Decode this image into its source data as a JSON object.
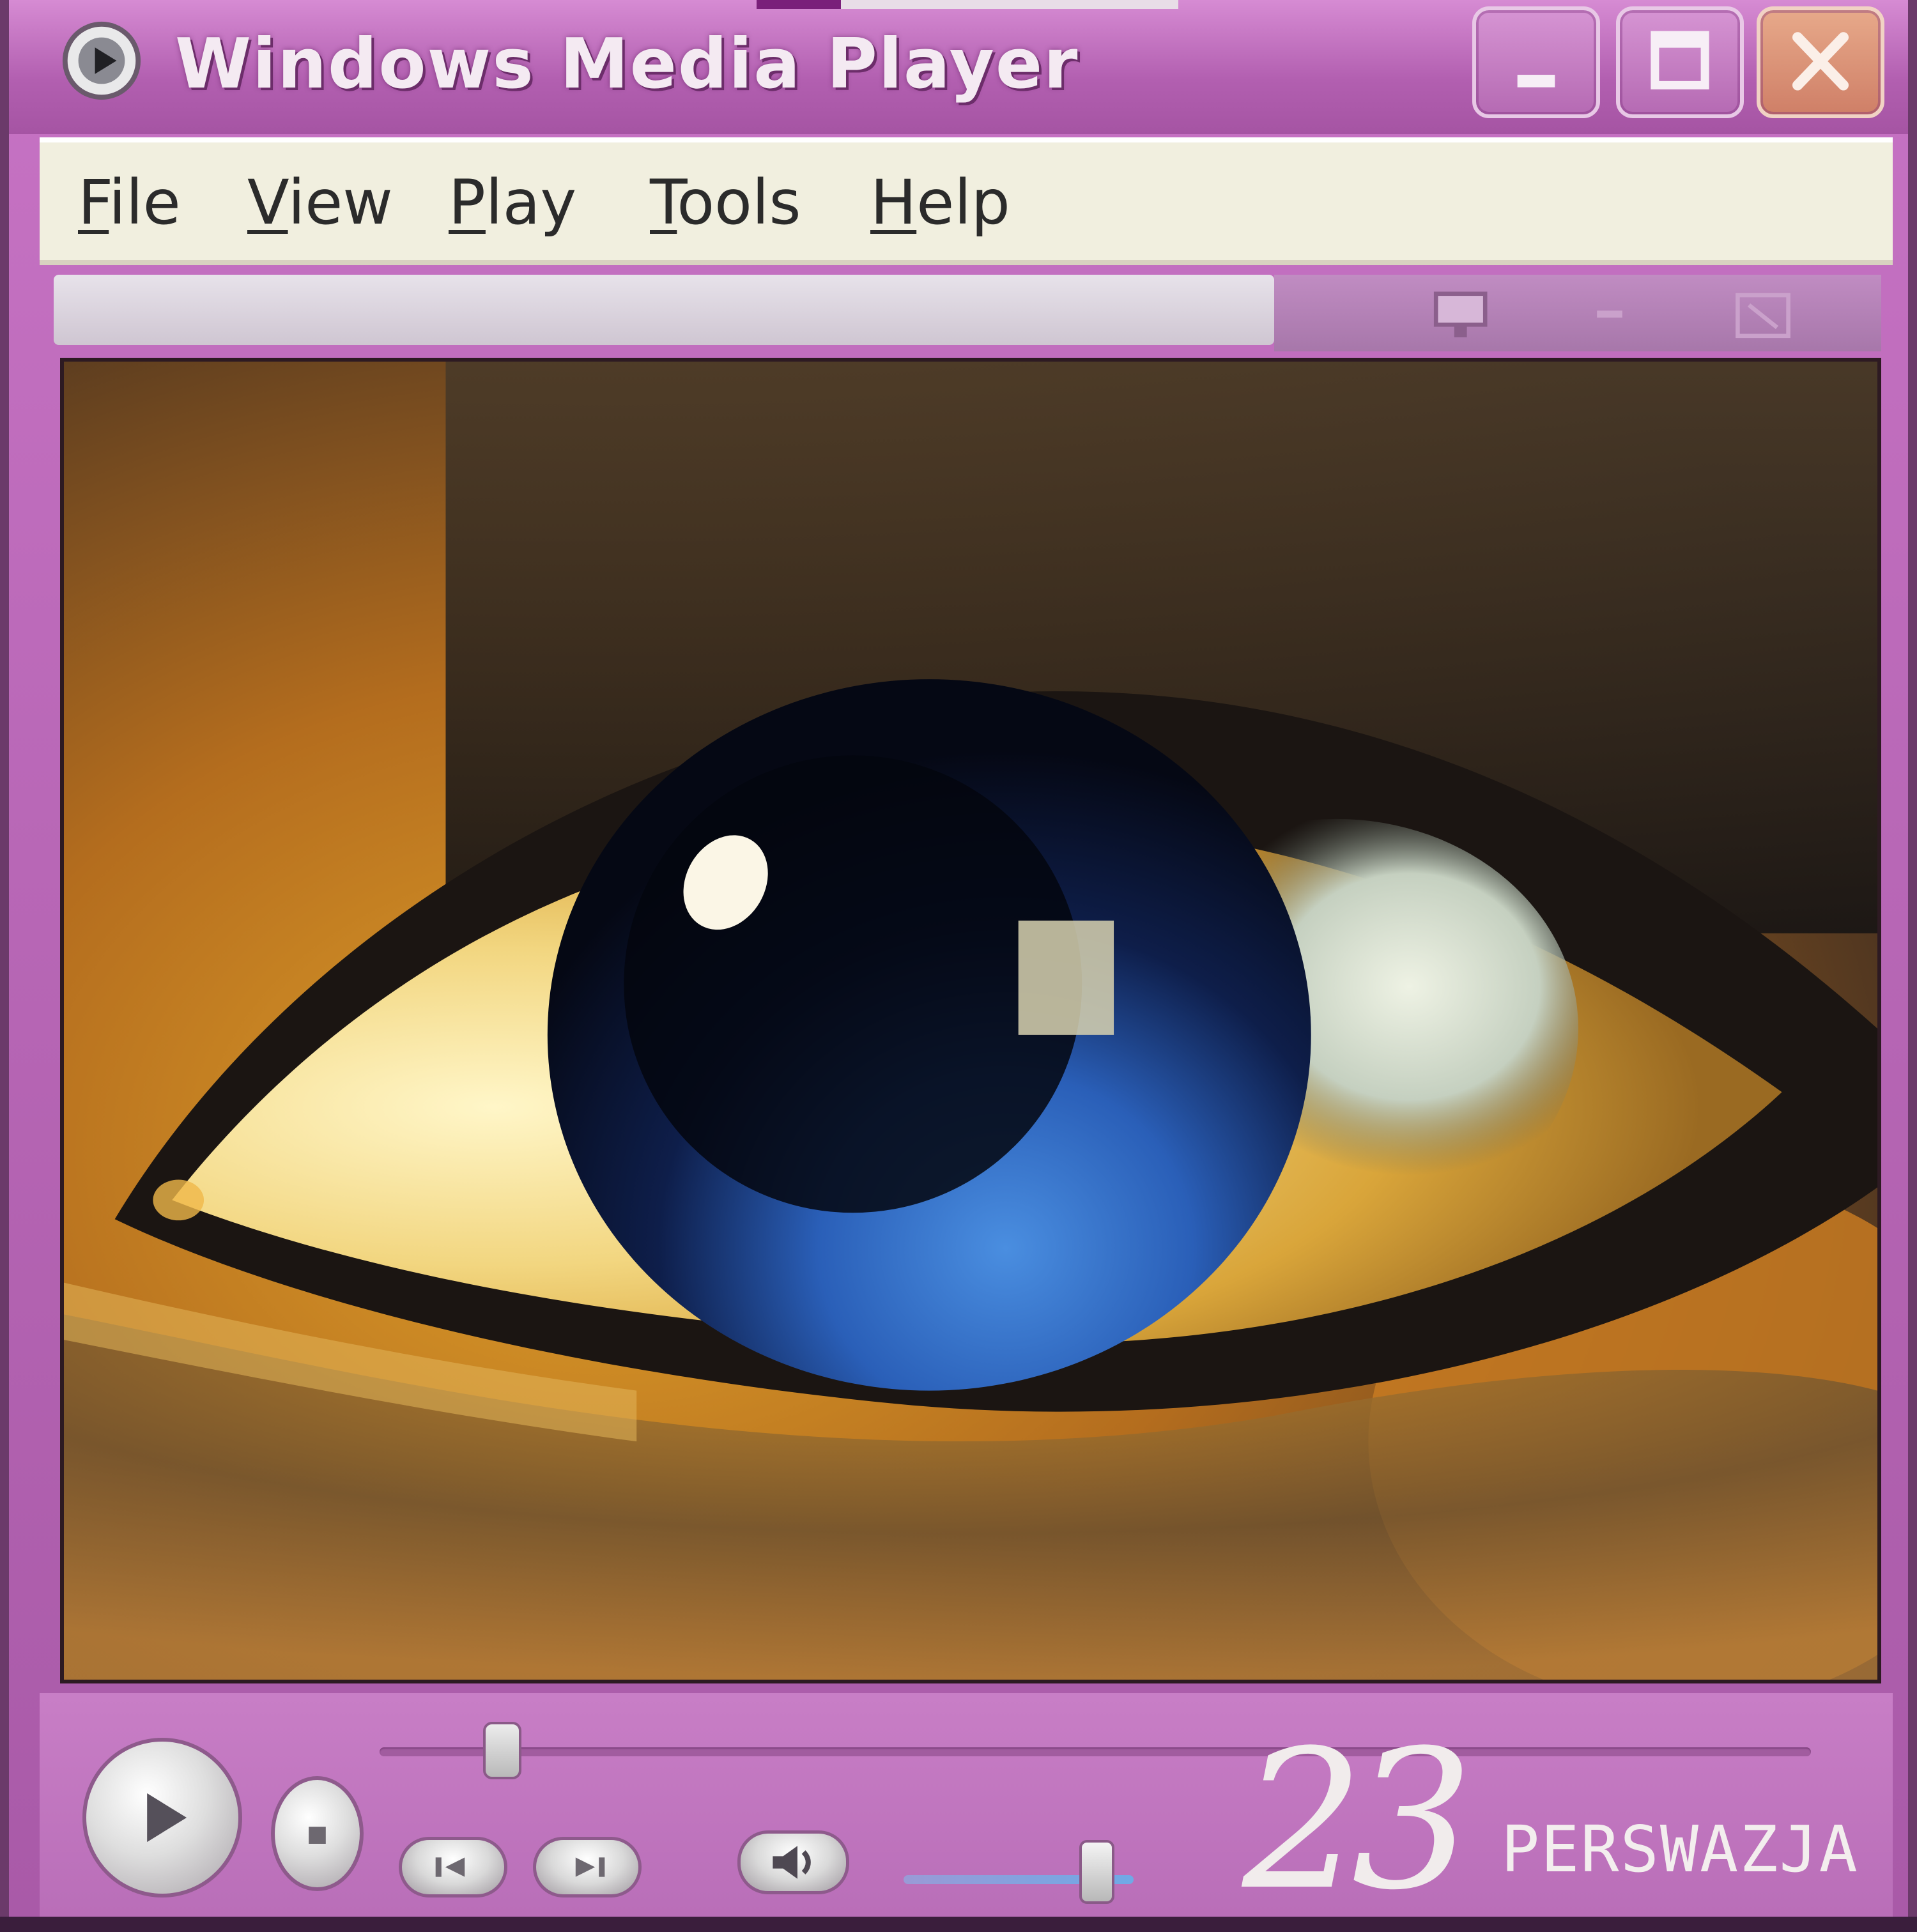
{
  "window": {
    "title": "Windows Media Player"
  },
  "menu": {
    "items": [
      {
        "mnemonic": "F",
        "rest": "ile"
      },
      {
        "mnemonic": "V",
        "rest": "iew"
      },
      {
        "mnemonic": "P",
        "rest": "lay"
      },
      {
        "mnemonic": "T",
        "rest": "ools"
      },
      {
        "mnemonic": "H",
        "rest": "elp"
      }
    ]
  },
  "icons": {
    "app": "media-player-icon",
    "minimize": "minimize-icon",
    "maximize": "maximize-icon",
    "close": "close-icon",
    "play": "play-icon",
    "stop": "stop-icon",
    "previous": "previous-track-icon",
    "next": "next-track-icon",
    "mute": "speaker-icon"
  },
  "playback": {
    "seek_position": 0.05,
    "volume": 0.8
  },
  "overlay": {
    "number": "23",
    "word": "PERSWAZJA"
  },
  "colors": {
    "chrome": "#b867b6",
    "menu_bg": "#f1efdf",
    "close_button": "#cf7f67"
  }
}
